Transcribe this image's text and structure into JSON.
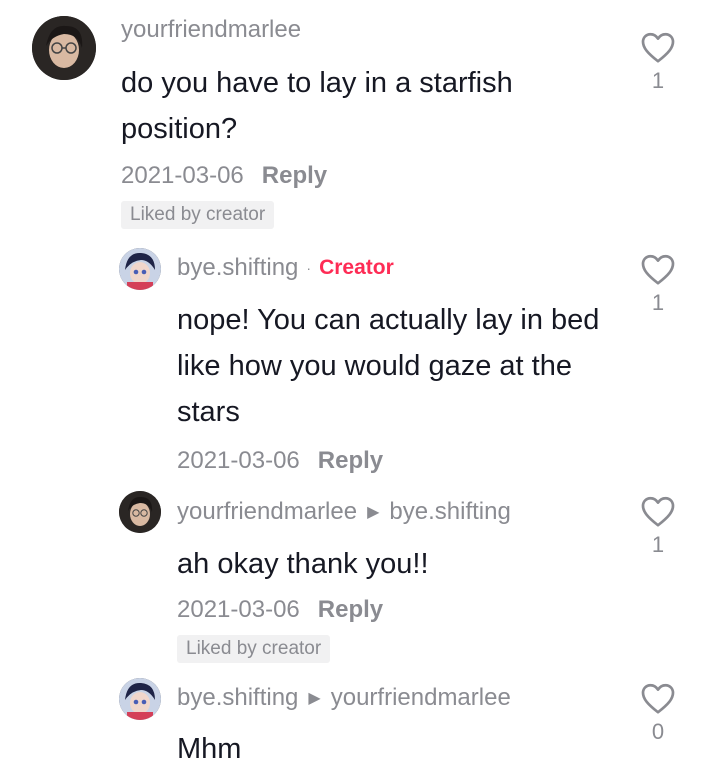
{
  "comments": [
    {
      "username": "yourfriendmarlee",
      "text": "do you have to lay in a starfish position?",
      "date": "2021-03-06",
      "reply_label": "Reply",
      "liked_label": "Liked by creator",
      "likes": "1"
    },
    {
      "username": "bye.shifting",
      "separator": "·",
      "badge": "Creator",
      "text": "nope! You can actually lay in bed like how you would gaze at the stars",
      "date": "2021-03-06",
      "reply_label": "Reply",
      "likes": "1"
    },
    {
      "username": "yourfriendmarlee",
      "reply_to": "bye.shifting",
      "text": "ah okay thank you!!",
      "date": "2021-03-06",
      "reply_label": "Reply",
      "liked_label": "Liked by creator",
      "likes": "1"
    },
    {
      "username": "bye.shifting",
      "reply_to": "yourfriendmarlee",
      "text": "Mhm",
      "likes": "0"
    }
  ],
  "icons": {
    "like": "heart-outline-icon",
    "reply_arrow": "triangle-right-icon"
  },
  "colors": {
    "creator_badge": "#fe2c55",
    "secondary_text": "#8a8b91",
    "primary_text": "#161823",
    "liked_chip_bg": "#f1f1f2"
  }
}
